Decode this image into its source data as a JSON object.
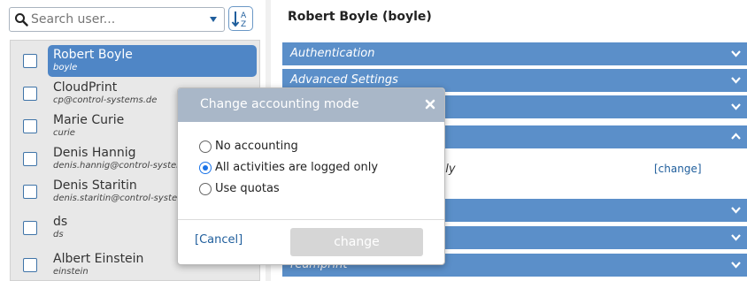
{
  "search": {
    "placeholder": "Search user...",
    "value": ""
  },
  "users": [
    {
      "name": "Robert Boyle",
      "login": "boyle",
      "selected": true
    },
    {
      "name": "CloudPrint",
      "login": "cp@control-systems.de"
    },
    {
      "name": "Marie Curie",
      "login": "curie"
    },
    {
      "name": "Denis Hannig",
      "login": "denis.hannig@control-systems.de"
    },
    {
      "name": "Denis Staritin",
      "login": "denis.staritin@control-systems.de"
    },
    {
      "name": "ds",
      "login": "ds"
    },
    {
      "name": "Albert Einstein",
      "login": "einstein"
    }
  ],
  "detail": {
    "title": "Robert Boyle (boyle)",
    "sections": [
      {
        "label": "Authentication"
      },
      {
        "label": "Advanced Settings"
      },
      {
        "label": ""
      },
      {
        "label": ""
      },
      {
        "label": ""
      },
      {
        "label": ""
      },
      {
        "label": "reamprint"
      }
    ],
    "accounting_mode_text": "nly",
    "change_link": "[change]"
  },
  "dialog": {
    "title": "Change accounting mode",
    "options": [
      {
        "label": "No accounting",
        "checked": false
      },
      {
        "label": "All activities are logged only",
        "checked": true
      },
      {
        "label": "Use quotas",
        "checked": false
      }
    ],
    "cancel_label": "[Cancel]",
    "change_label": "change"
  },
  "colors": {
    "accent": "#5b8fc9",
    "selected": "#4f86c6",
    "link": "#1f5e9c",
    "dialog_header": "#a9b7c8"
  },
  "icons": {
    "search": "search-icon",
    "sort": "sort-az-icon",
    "chevron": "chevron-down-icon",
    "close": "close-icon"
  }
}
